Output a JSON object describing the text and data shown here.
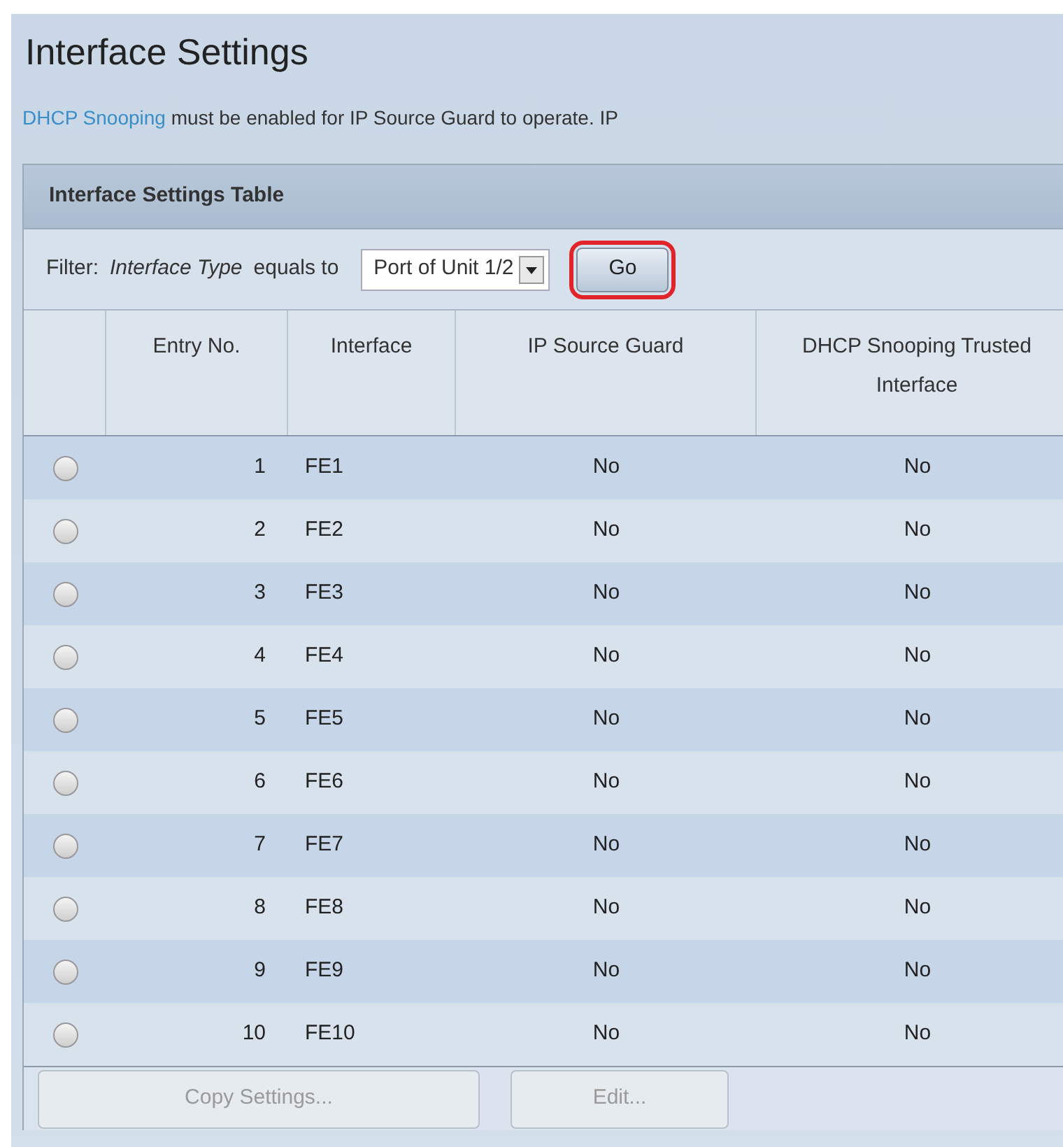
{
  "page": {
    "title": "Interface Settings",
    "notice": {
      "link": "DHCP Snooping",
      "text": "must be enabled for IP Source Guard to operate. IP"
    }
  },
  "table": {
    "title": "Interface Settings Table",
    "filter": {
      "label": "Filter:",
      "field": "Interface Type",
      "operator": "equals to",
      "value": "Port of Unit 1/2",
      "button": "Go",
      "highlighted": true
    },
    "columns": [
      "Entry No.",
      "Interface",
      "IP Source Guard",
      "DHCP Snooping Trusted Interface"
    ],
    "rows": [
      {
        "entry": "1",
        "interface": "FE1",
        "ip_source_guard": "No",
        "trusted": "No",
        "selected": false
      },
      {
        "entry": "2",
        "interface": "FE2",
        "ip_source_guard": "No",
        "trusted": "No",
        "selected": false
      },
      {
        "entry": "3",
        "interface": "FE3",
        "ip_source_guard": "No",
        "trusted": "No",
        "selected": false
      },
      {
        "entry": "4",
        "interface": "FE4",
        "ip_source_guard": "No",
        "trusted": "No",
        "selected": false
      },
      {
        "entry": "5",
        "interface": "FE5",
        "ip_source_guard": "No",
        "trusted": "No",
        "selected": false
      },
      {
        "entry": "6",
        "interface": "FE6",
        "ip_source_guard": "No",
        "trusted": "No",
        "selected": false
      },
      {
        "entry": "7",
        "interface": "FE7",
        "ip_source_guard": "No",
        "trusted": "No",
        "selected": false
      },
      {
        "entry": "8",
        "interface": "FE8",
        "ip_source_guard": "No",
        "trusted": "No",
        "selected": false
      },
      {
        "entry": "9",
        "interface": "FE9",
        "ip_source_guard": "No",
        "trusted": "No",
        "selected": false
      },
      {
        "entry": "10",
        "interface": "FE10",
        "ip_source_guard": "No",
        "trusted": "No",
        "selected": false
      }
    ],
    "buttons": [
      {
        "label": "Copy Settings...",
        "disabled": true
      },
      {
        "label": "Edit...",
        "disabled": true
      }
    ]
  }
}
